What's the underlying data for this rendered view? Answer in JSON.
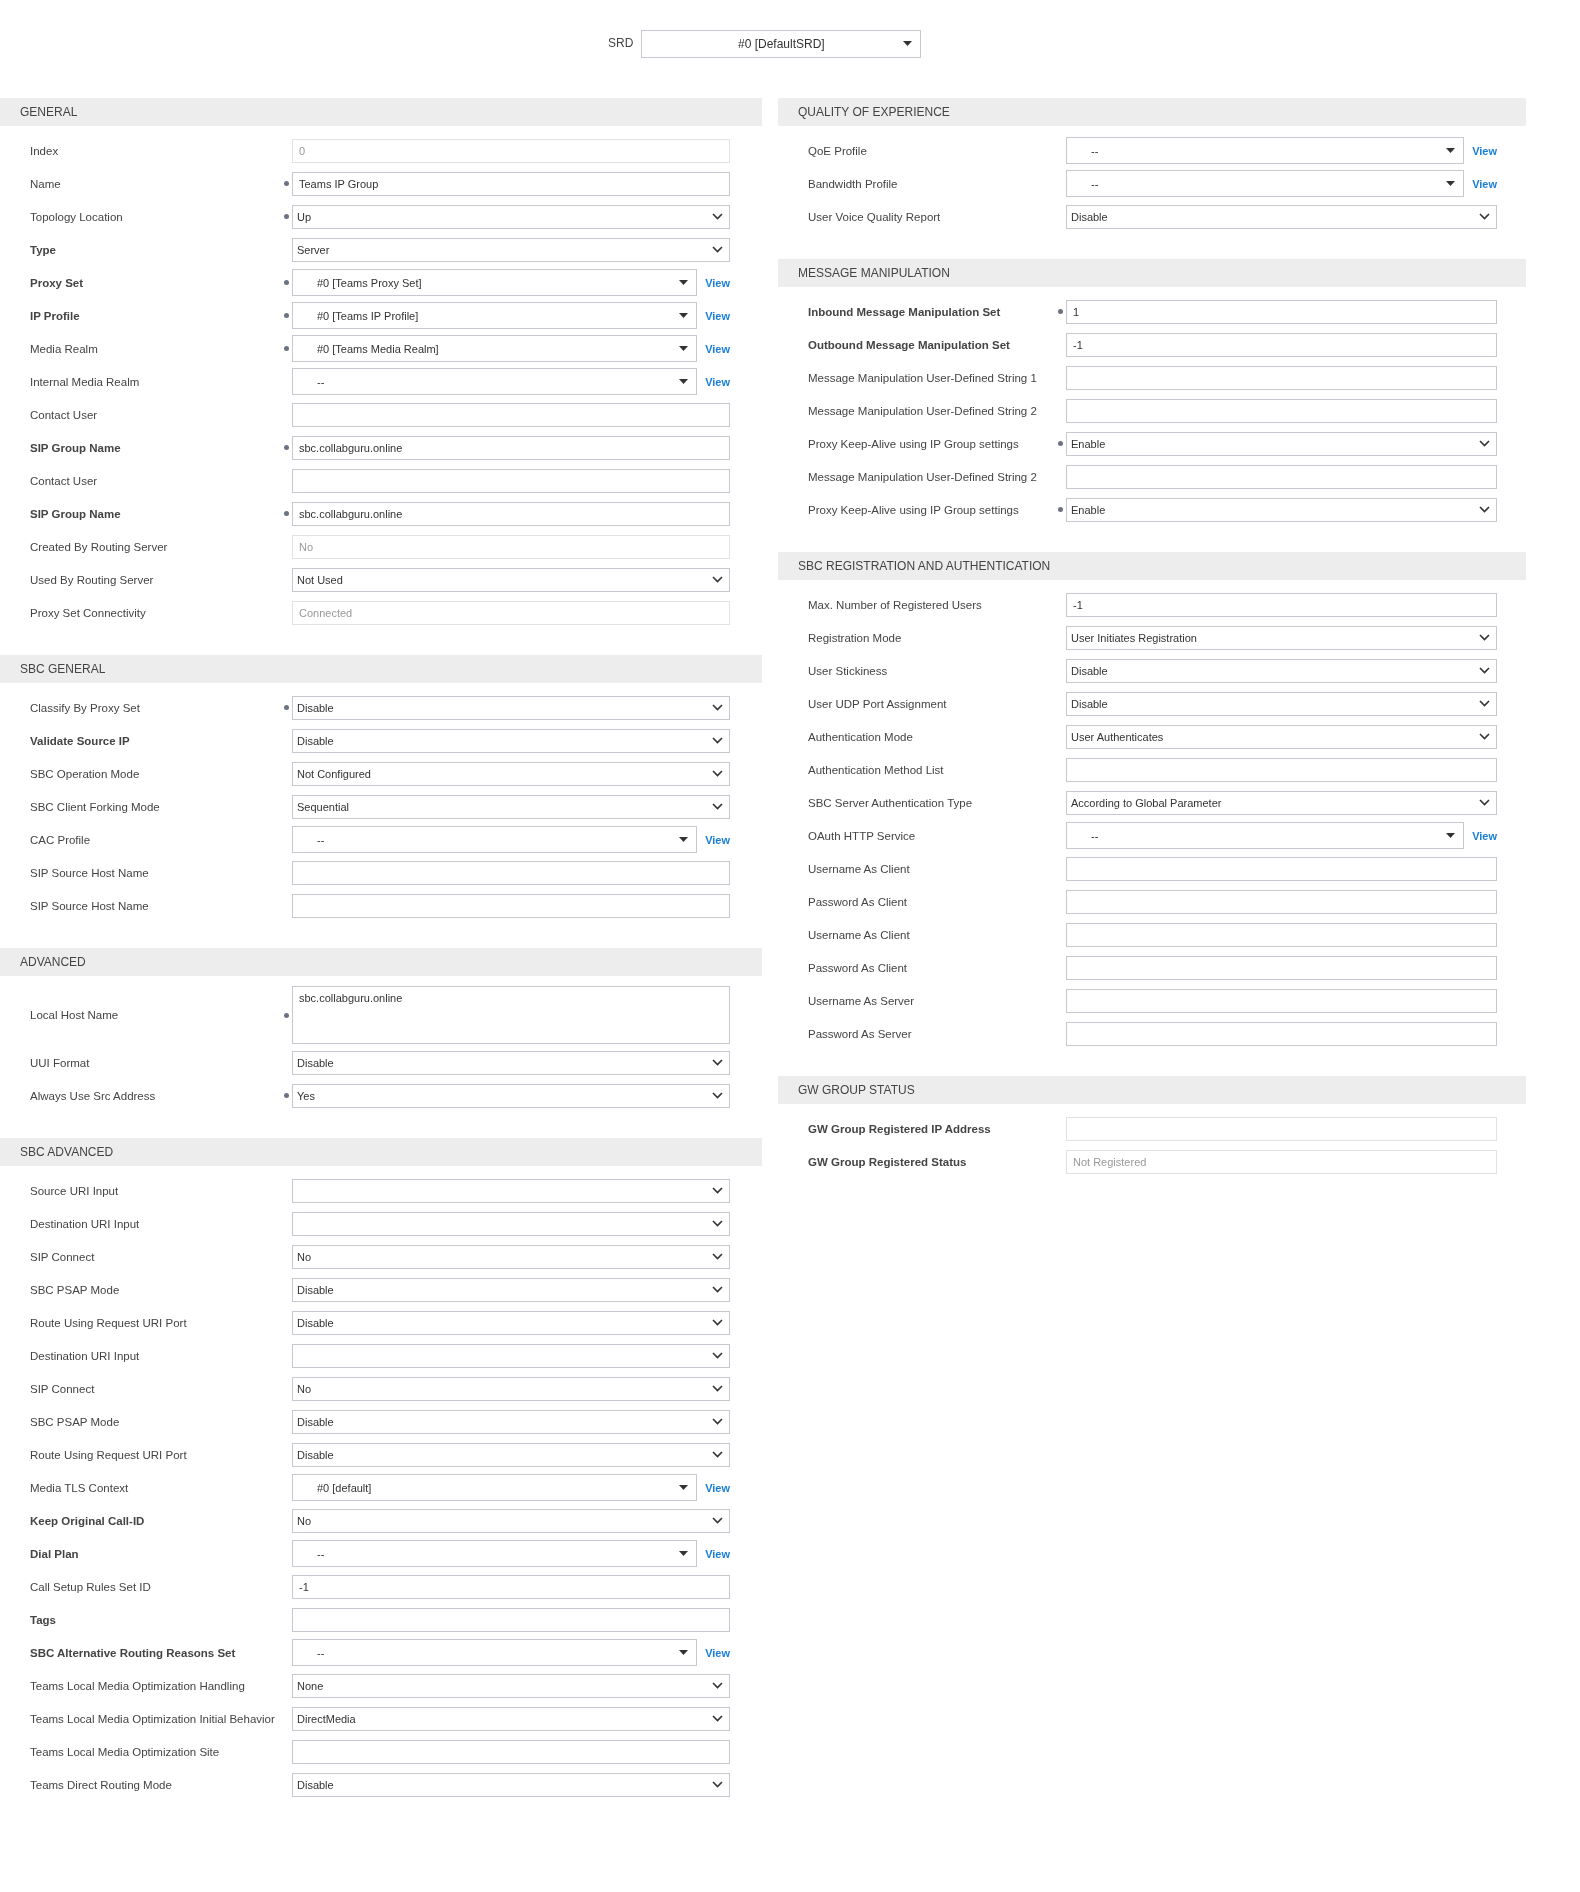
{
  "srd": {
    "label": "SRD",
    "value": "#0 [DefaultSRD]"
  },
  "columns": [
    {
      "sections": [
        {
          "title": "GENERAL",
          "fields": [
            {
              "label": "Index",
              "bold": false,
              "required": false,
              "kind": "text",
              "value": "0",
              "disabled": true
            },
            {
              "label": "Name",
              "bold": false,
              "required": true,
              "kind": "text",
              "value": "Teams IP Group",
              "disabled": false
            },
            {
              "label": "Topology Location",
              "bold": false,
              "required": true,
              "kind": "select",
              "value": "Up"
            },
            {
              "label": "Type",
              "bold": true,
              "required": false,
              "kind": "select",
              "value": "Server"
            },
            {
              "label": "Proxy Set",
              "bold": true,
              "required": true,
              "kind": "lookup",
              "value": "#0 [Teams Proxy Set]",
              "link": "View"
            },
            {
              "label": "IP Profile",
              "bold": true,
              "required": true,
              "kind": "lookup",
              "value": "#0 [Teams IP Profile]",
              "link": "View"
            },
            {
              "label": "Media Realm",
              "bold": false,
              "required": true,
              "kind": "lookup",
              "value": "#0 [Teams Media Realm]",
              "link": "View"
            },
            {
              "label": "Internal Media Realm",
              "bold": false,
              "required": false,
              "kind": "lookup",
              "value": "--",
              "link": "View"
            },
            {
              "label": "Contact User",
              "bold": false,
              "required": false,
              "kind": "text",
              "disabled": false
            },
            {
              "label": "SIP Group Name",
              "bold": true,
              "required": true,
              "kind": "text",
              "value": "sbc.collabguru.online",
              "disabled": false
            },
            {
              "label": "Contact User",
              "bold": false,
              "required": false,
              "kind": "text",
              "disabled": false
            },
            {
              "label": "SIP Group Name",
              "bold": true,
              "required": true,
              "kind": "text",
              "value": "sbc.collabguru.online",
              "disabled": false
            },
            {
              "label": "Created By Routing Server",
              "bold": false,
              "required": false,
              "kind": "text",
              "value": "No",
              "disabled": true
            },
            {
              "label": "Used By Routing Server",
              "bold": false,
              "required": false,
              "kind": "select",
              "value": "Not Used"
            },
            {
              "label": "Proxy Set Connectivity",
              "bold": false,
              "required": false,
              "kind": "text",
              "value": "Connected",
              "disabled": true
            }
          ]
        },
        {
          "title": "SBC GENERAL",
          "fields": [
            {
              "label": "Classify By Proxy Set",
              "bold": false,
              "required": true,
              "kind": "select",
              "value": "Disable"
            },
            {
              "label": "Validate Source IP",
              "bold": true,
              "required": false,
              "kind": "select",
              "value": "Disable"
            },
            {
              "label": "SBC Operation Mode",
              "bold": false,
              "required": false,
              "kind": "select",
              "value": "Not Configured"
            },
            {
              "label": "SBC Client Forking Mode",
              "bold": false,
              "required": false,
              "kind": "select",
              "value": "Sequential"
            },
            {
              "label": "CAC Profile",
              "bold": false,
              "required": false,
              "kind": "lookup",
              "value": "--",
              "link": "View"
            },
            {
              "label": "SIP Source Host Name",
              "bold": false,
              "required": false,
              "kind": "text",
              "disabled": false
            },
            {
              "label": "SIP Source Host Name",
              "bold": false,
              "required": false,
              "kind": "text",
              "disabled": false
            }
          ]
        },
        {
          "title": "ADVANCED",
          "fields": [
            {
              "label": "Local Host Name",
              "bold": false,
              "required": true,
              "kind": "textarea",
              "value": "sbc.collabguru.online"
            },
            {
              "label": "UUI Format",
              "bold": false,
              "required": false,
              "kind": "select",
              "value": "Disable"
            },
            {
              "label": "Always Use Src Address",
              "bold": false,
              "required": true,
              "kind": "select",
              "value": "Yes"
            }
          ]
        },
        {
          "title": "SBC ADVANCED",
          "fields": [
            {
              "label": "Source URI Input",
              "bold": false,
              "required": false,
              "kind": "select"
            },
            {
              "label": "Destination URI Input",
              "bold": false,
              "required": false,
              "kind": "select"
            },
            {
              "label": "SIP Connect",
              "bold": false,
              "required": false,
              "kind": "select",
              "value": "No"
            },
            {
              "label": "SBC PSAP Mode",
              "bold": false,
              "required": false,
              "kind": "select",
              "value": "Disable"
            },
            {
              "label": "Route Using Request URI Port",
              "bold": false,
              "required": false,
              "kind": "select",
              "value": "Disable"
            },
            {
              "label": "Destination URI Input",
              "bold": false,
              "required": false,
              "kind": "select"
            },
            {
              "label": "SIP Connect",
              "bold": false,
              "required": false,
              "kind": "select",
              "value": "No"
            },
            {
              "label": "SBC PSAP Mode",
              "bold": false,
              "required": false,
              "kind": "select",
              "value": "Disable"
            },
            {
              "label": "Route Using Request URI Port",
              "bold": false,
              "required": false,
              "kind": "select",
              "value": "Disable"
            },
            {
              "label": "Media TLS Context",
              "bold": false,
              "required": false,
              "kind": "lookup",
              "value": "#0 [default]",
              "link": "View"
            },
            {
              "label": "Keep Original Call-ID",
              "bold": true,
              "required": false,
              "kind": "select",
              "value": "No"
            },
            {
              "label": "Dial Plan",
              "bold": true,
              "required": false,
              "kind": "lookup",
              "value": "--",
              "link": "View"
            },
            {
              "label": "Call Setup Rules Set ID",
              "bold": false,
              "required": false,
              "kind": "text",
              "value": "-1",
              "disabled": false
            },
            {
              "label": "Tags",
              "bold": true,
              "required": false,
              "kind": "text",
              "disabled": false
            },
            {
              "label": "SBC Alternative Routing Reasons Set",
              "bold": true,
              "required": false,
              "kind": "lookup",
              "value": "--",
              "link": "View"
            },
            {
              "label": "Teams Local Media Optimization Handling",
              "bold": false,
              "required": false,
              "kind": "select",
              "value": "None"
            },
            {
              "label": "Teams Local Media Optimization Initial Behavior",
              "bold": false,
              "required": false,
              "kind": "select",
              "value": "DirectMedia"
            },
            {
              "label": "Teams Local Media Optimization Site",
              "bold": false,
              "required": false,
              "kind": "text",
              "disabled": false
            },
            {
              "label": "Teams Direct Routing Mode",
              "bold": false,
              "required": false,
              "kind": "select",
              "value": "Disable"
            }
          ]
        }
      ]
    },
    {
      "sections": [
        {
          "title": "QUALITY OF EXPERIENCE",
          "fields": [
            {
              "label": "QoE Profile",
              "bold": false,
              "required": false,
              "kind": "lookup",
              "value": "--",
              "link": "View"
            },
            {
              "label": "Bandwidth Profile",
              "bold": false,
              "required": false,
              "kind": "lookup",
              "value": "--",
              "link": "View"
            },
            {
              "label": "User Voice Quality Report",
              "bold": false,
              "required": false,
              "kind": "select",
              "value": "Disable"
            }
          ]
        },
        {
          "title": "MESSAGE MANIPULATION",
          "fields": [
            {
              "label": "Inbound Message Manipulation Set",
              "bold": true,
              "required": true,
              "kind": "text",
              "value": "1",
              "disabled": false
            },
            {
              "label": "Outbound Message Manipulation Set",
              "bold": true,
              "required": false,
              "kind": "text",
              "value": "-1",
              "disabled": false
            },
            {
              "label": "Message Manipulation User-Defined String 1",
              "bold": false,
              "required": false,
              "kind": "text",
              "disabled": false
            },
            {
              "label": "Message Manipulation User-Defined String 2",
              "bold": false,
              "required": false,
              "kind": "text",
              "disabled": false
            },
            {
              "label": "Proxy Keep-Alive using IP Group settings",
              "bold": false,
              "required": true,
              "kind": "select",
              "value": "Enable"
            },
            {
              "label": "Message Manipulation User-Defined String 2",
              "bold": false,
              "required": false,
              "kind": "text",
              "disabled": false
            },
            {
              "label": "Proxy Keep-Alive using IP Group settings",
              "bold": false,
              "required": true,
              "kind": "select",
              "value": "Enable"
            }
          ]
        },
        {
          "title": "SBC REGISTRATION AND AUTHENTICATION",
          "fields": [
            {
              "label": "Max. Number of Registered Users",
              "bold": false,
              "required": false,
              "kind": "text",
              "value": "-1",
              "disabled": false
            },
            {
              "label": "Registration Mode",
              "bold": false,
              "required": false,
              "kind": "select",
              "value": "User Initiates Registration"
            },
            {
              "label": "User Stickiness",
              "bold": false,
              "required": false,
              "kind": "select",
              "value": "Disable"
            },
            {
              "label": "User UDP Port Assignment",
              "bold": false,
              "required": false,
              "kind": "select",
              "value": "Disable"
            },
            {
              "label": "Authentication Mode",
              "bold": false,
              "required": false,
              "kind": "select",
              "value": "User Authenticates"
            },
            {
              "label": "Authentication Method List",
              "bold": false,
              "required": false,
              "kind": "text",
              "disabled": false
            },
            {
              "label": "SBC Server Authentication Type",
              "bold": false,
              "required": false,
              "kind": "select",
              "value": "According to Global Parameter"
            },
            {
              "label": "OAuth HTTP Service",
              "bold": false,
              "required": false,
              "kind": "lookup",
              "value": "--",
              "link": "View"
            },
            {
              "label": "Username As Client",
              "bold": false,
              "required": false,
              "kind": "text",
              "disabled": false
            },
            {
              "label": "Password As Client",
              "bold": false,
              "required": false,
              "kind": "text",
              "disabled": false
            },
            {
              "label": "Username As Client",
              "bold": false,
              "required": false,
              "kind": "text",
              "disabled": false
            },
            {
              "label": "Password As Client",
              "bold": false,
              "required": false,
              "kind": "text",
              "disabled": false
            },
            {
              "label": "Username As Server",
              "bold": false,
              "required": false,
              "kind": "text",
              "disabled": false
            },
            {
              "label": "Password As Server",
              "bold": false,
              "required": false,
              "kind": "text",
              "disabled": false
            }
          ]
        },
        {
          "title": "GW GROUP STATUS",
          "fields": [
            {
              "label": "GW Group Registered IP Address",
              "bold": true,
              "required": false,
              "kind": "text",
              "disabled": true
            },
            {
              "label": "GW Group Registered Status",
              "bold": true,
              "required": false,
              "kind": "text",
              "value": "Not Registered",
              "disabled": true
            }
          ]
        }
      ]
    }
  ]
}
